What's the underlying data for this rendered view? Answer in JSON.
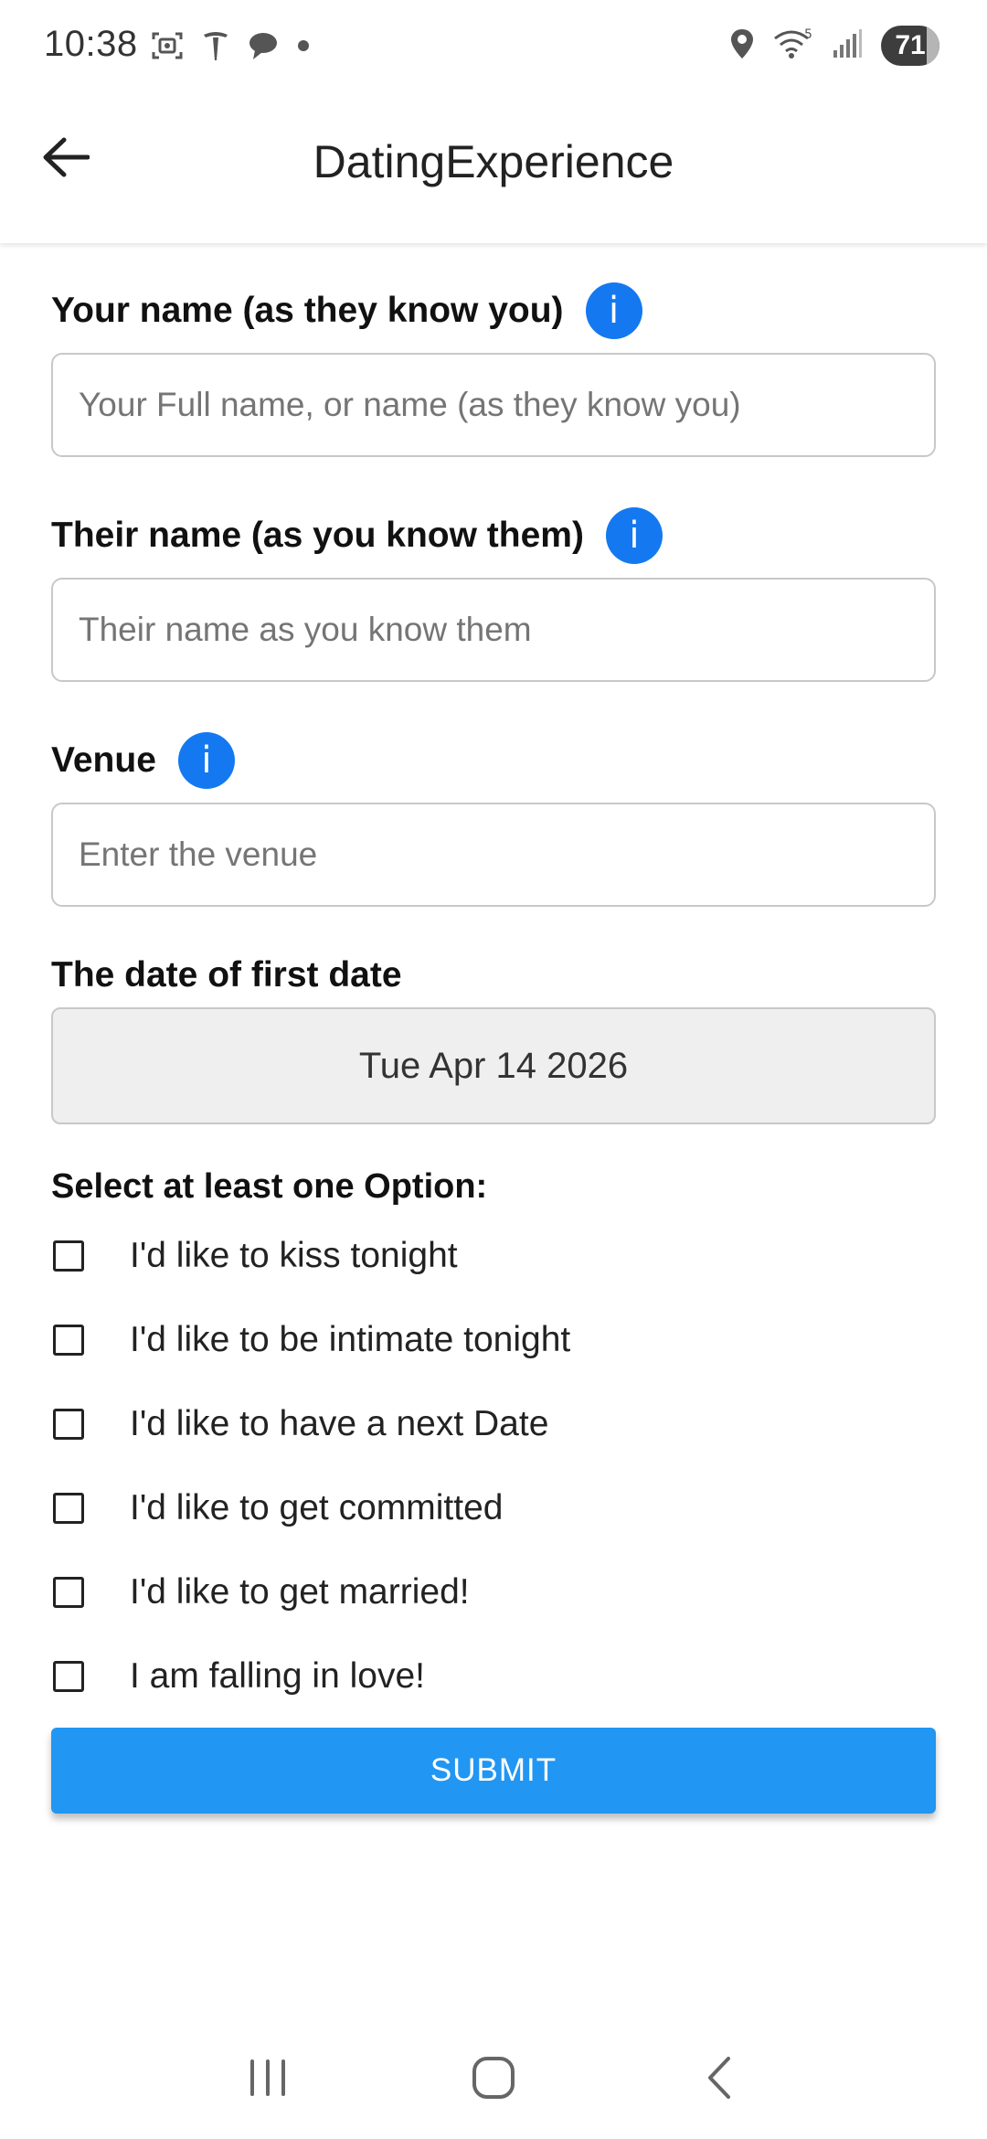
{
  "status_bar": {
    "time": "10:38",
    "battery": "71",
    "left_icons": [
      "screenshot-icon",
      "tesla-icon",
      "chat-icon",
      "dot-icon"
    ],
    "right_icons": [
      "location-icon",
      "wifi-icon",
      "signal-icon",
      "battery-icon"
    ]
  },
  "app_bar": {
    "title": "DatingExperience",
    "back_icon": "arrow-left-icon"
  },
  "form": {
    "your_name": {
      "label": "Your name (as they know you)",
      "placeholder": "Your Full name, or name (as they know you)",
      "value": ""
    },
    "their_name": {
      "label": "Their name (as you know them)",
      "placeholder": "Their name as you know them",
      "value": ""
    },
    "venue": {
      "label": "Venue",
      "placeholder": "Enter the venue",
      "value": ""
    },
    "first_date": {
      "label": "The date of first date",
      "value": "Tue Apr 14 2026"
    },
    "info_glyph": "i",
    "options_title": "Select at least one Option:",
    "options": [
      {
        "label": "I'd like to kiss tonight",
        "checked": false
      },
      {
        "label": "I'd like to be intimate tonight",
        "checked": false
      },
      {
        "label": "I'd like to have a next Date",
        "checked": false
      },
      {
        "label": "I'd like to get committed",
        "checked": false
      },
      {
        "label": "I'd like to get married!",
        "checked": false
      },
      {
        "label": "I am falling in love!",
        "checked": false
      }
    ],
    "submit_label": "SUBMIT"
  },
  "colors": {
    "accent": "#2196f3",
    "info": "#1479f0",
    "date_field_bg": "#efefef"
  },
  "nav_bar": {
    "icons": [
      "recent-apps-icon",
      "home-icon",
      "back-icon"
    ]
  }
}
